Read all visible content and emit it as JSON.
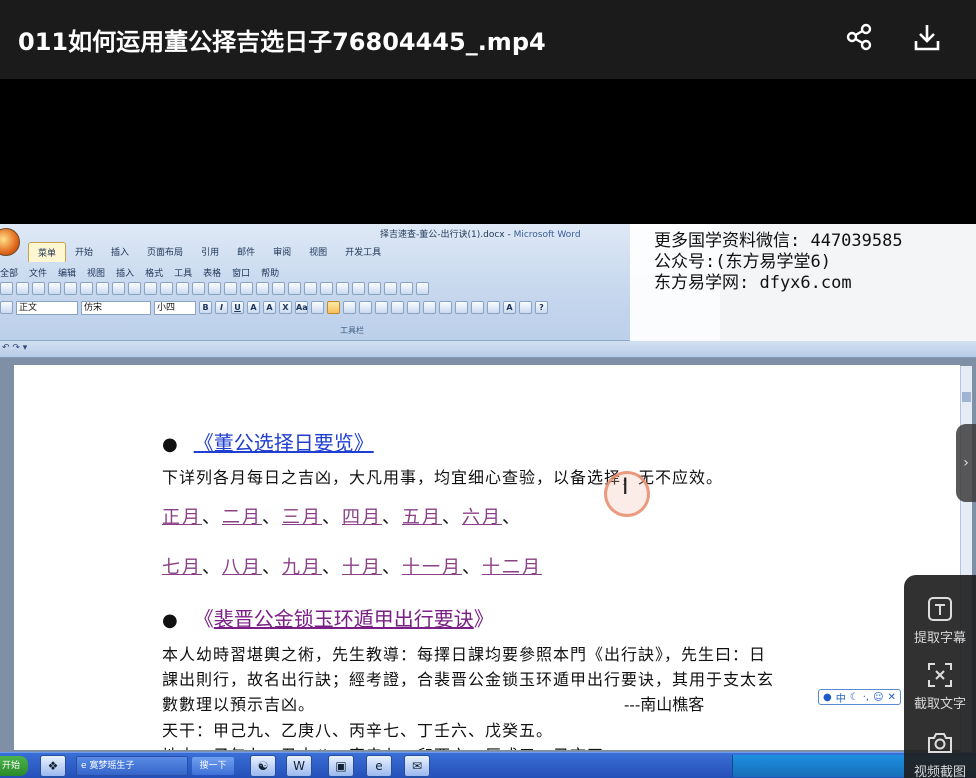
{
  "player": {
    "title": "011如何运用董公择吉选日子76804445_.mp4",
    "share_icon": "share-icon",
    "download_icon": "download-icon"
  },
  "word": {
    "window_title": "择吉速查-董公-出行诀(1).docx - ",
    "app_name": "Microsoft Word",
    "tabs": [
      "菜单",
      "开始",
      "插入",
      "页面布局",
      "引用",
      "邮件",
      "审阅",
      "视图",
      "开发工具"
    ],
    "menus": [
      "全部",
      "文件",
      "编辑",
      "视图",
      "插入",
      "格式",
      "工具",
      "表格",
      "窗口",
      "帮助"
    ],
    "style_value": "正文",
    "font_value": "仿宋",
    "size_value": "小四",
    "toolbar_group_label": "工具栏"
  },
  "overlay": {
    "line1": "更多国学资料微信: 447039585",
    "line2": "公众号:(东方易学堂6)",
    "line3": "东方易学网: dfyx6.com"
  },
  "document": {
    "heading1": "《董公选择日要览》",
    "para1_a": "下详列各月每日之吉凶，大凡用事，均宜细心查验，",
    "para1_b": "以备选择，无不应效。",
    "months_row1": [
      "正月",
      "二月",
      "三月",
      "四月",
      "五月",
      "六月"
    ],
    "months_row2": [
      "七月",
      "八月",
      "九月",
      "十月",
      "十一月",
      "十二月"
    ],
    "separator": "、",
    "heading2_open": "《",
    "heading2_link": "裴晋公金锁玉环遁甲出行要诀",
    "heading2_close": "》",
    "body1": "本人幼時習堪輿之術，先生教導：每擇日課均要參照本門《出行訣》，先生曰：日",
    "body2": "課出則行，故名出行訣；經考證，合裴晋公金锁玉环遁甲出行要诀，其用于支太玄",
    "body3": "數數理以預示吉凶。",
    "signature": "---南山樵客",
    "body4": "天干：甲己九、乙庚八、丙辛七、丁壬六、戊癸五。",
    "body5": "地支：子午九、丑未八、寅申七、卯酉六、辰戌五、己亥四。"
  },
  "ime": {
    "label": "中"
  },
  "taskbar": {
    "start": "开始",
    "app1": "寞梦瑶生子",
    "search_btn": "搜一下"
  },
  "side_panel": {
    "extract_subtitle": "提取字幕",
    "extract_text": "截取文字",
    "screenshot": "视频截图"
  }
}
